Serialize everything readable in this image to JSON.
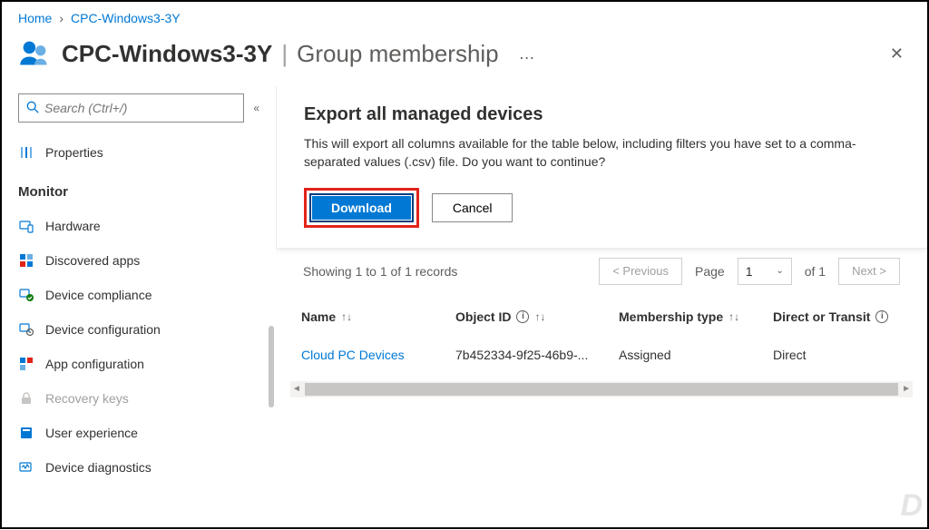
{
  "breadcrumb": {
    "home": "Home",
    "current": "CPC-Windows3-3Y"
  },
  "header": {
    "title": "CPC-Windows3-3Y",
    "subtitle": "Group membership",
    "more": "…"
  },
  "search": {
    "placeholder": "Search (Ctrl+/)"
  },
  "sidebar": {
    "properties": "Properties",
    "monitor_label": "Monitor",
    "items": {
      "hardware": "Hardware",
      "discovered": "Discovered apps",
      "compliance": "Device compliance",
      "configuration": "Device configuration",
      "appconfig": "App configuration",
      "recovery": "Recovery keys",
      "userexp": "User experience",
      "diagnostics": "Device diagnostics"
    }
  },
  "dialog": {
    "title": "Export all managed devices",
    "body": "This will export all columns available for the table below, including filters you have set to a comma-separated values (.csv) file. Do you want to continue?",
    "download": "Download",
    "cancel": "Cancel"
  },
  "pager": {
    "summary": "Showing 1 to 1 of 1 records",
    "prev": "< Previous",
    "page_label": "Page",
    "page_value": "1",
    "of_label": "of 1",
    "next": "Next >"
  },
  "table": {
    "cols": {
      "name": "Name",
      "objectid": "Object ID",
      "membership": "Membership type",
      "direct": "Direct or Transit"
    },
    "row": {
      "name": "Cloud PC Devices",
      "objectid": "7b452334-9f25-46b9-...",
      "membership": "Assigned",
      "direct": "Direct"
    }
  },
  "watermark": "D"
}
